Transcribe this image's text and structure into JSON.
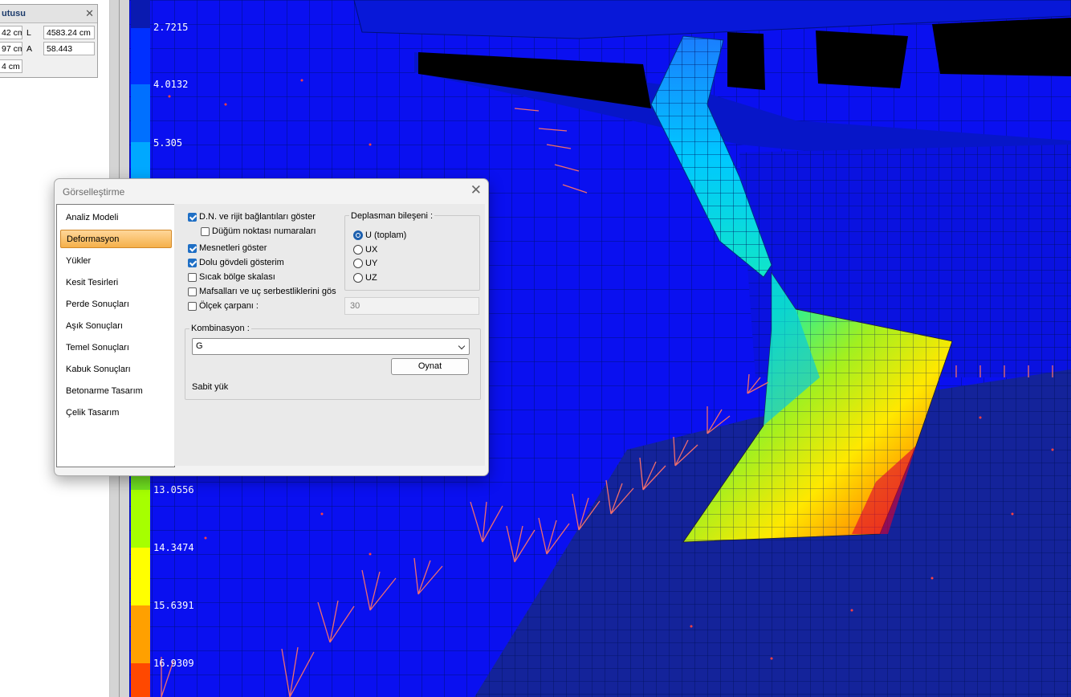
{
  "info_panel": {
    "title": "utusu",
    "cells": [
      "42 cm",
      "4583.24 cm",
      "97 cm",
      "58.443",
      "4 cm"
    ],
    "labels": [
      "L",
      "A"
    ]
  },
  "legend": {
    "values": [
      "2.7215",
      "4.0132",
      "5.305",
      "13.0556",
      "14.3474",
      "15.6391",
      "16.9309"
    ]
  },
  "colors": {
    "mesh_blue": "#0a10f0",
    "support_marks": "#f06d6d",
    "accent": "#1f6fc5",
    "selected_nav": "#f5b04a"
  },
  "dialog": {
    "title": "Görselleştirme",
    "nav_items": [
      {
        "label": "Analiz Modeli",
        "selected": false
      },
      {
        "label": "Deformasyon",
        "selected": true
      },
      {
        "label": "Yükler",
        "selected": false
      },
      {
        "label": "Kesit Tesirleri",
        "selected": false
      },
      {
        "label": "Perde Sonuçları",
        "selected": false
      },
      {
        "label": "Aşık Sonuçları",
        "selected": false
      },
      {
        "label": "Temel Sonuçları",
        "selected": false
      },
      {
        "label": "Kabuk Sonuçları",
        "selected": false
      },
      {
        "label": "Betonarme Tasarım",
        "selected": false
      },
      {
        "label": "Çelik Tasarım",
        "selected": false
      }
    ],
    "checkboxes": [
      {
        "label": "D.N. ve rijit bağlantıları göster",
        "checked": true
      },
      {
        "label": "Düğüm noktası numaraları",
        "checked": false
      },
      {
        "label": "Mesnetleri göster",
        "checked": true
      },
      {
        "label": "Dolu gövdeli gösterim",
        "checked": true
      },
      {
        "label": "Sıcak bölge skalası",
        "checked": false
      },
      {
        "label": "Mafsalları ve uç serbestliklerini  gös",
        "checked": false
      },
      {
        "label": "Ölçek çarpanı :",
        "checked": false
      }
    ],
    "scale_value": "30",
    "displacement": {
      "title": "Deplasman bileşeni :",
      "options": [
        {
          "label": "U (toplam)",
          "selected": true
        },
        {
          "label": "UX",
          "selected": false
        },
        {
          "label": "UY",
          "selected": false
        },
        {
          "label": "UZ",
          "selected": false
        }
      ]
    },
    "combination": {
      "title": "Kombinasyon :",
      "selected": "G",
      "play_button": "Oynat",
      "description": "Sabit yük"
    }
  }
}
